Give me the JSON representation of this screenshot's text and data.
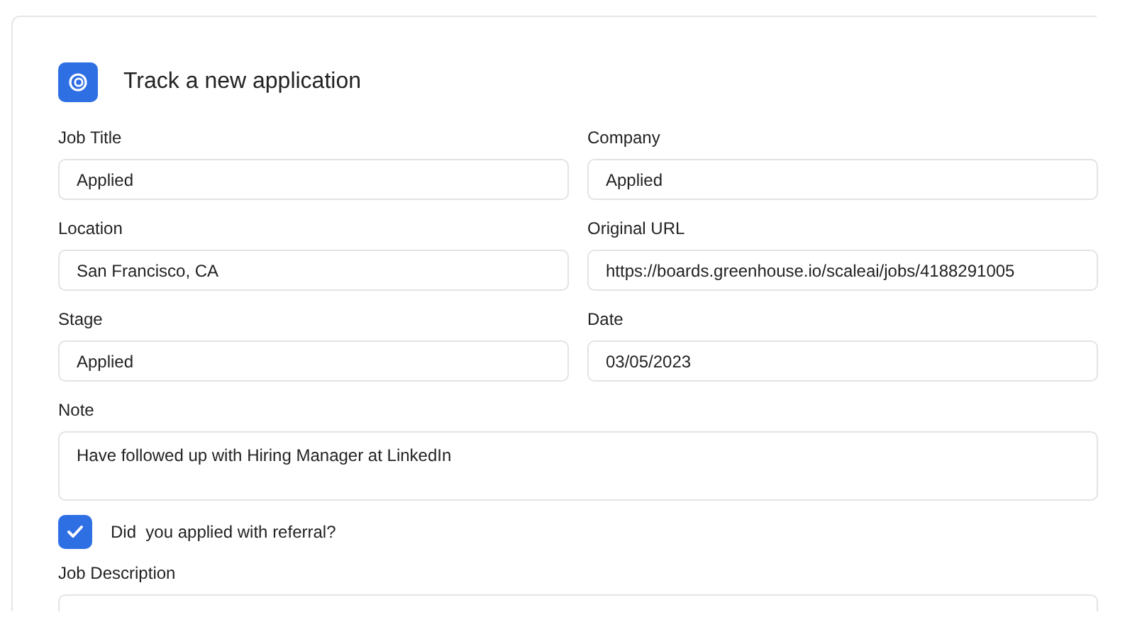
{
  "title": "Track a new application",
  "fields": [
    {
      "label": "Job Title",
      "value": "Applied"
    },
    {
      "label": "Company",
      "value": "Applied"
    },
    {
      "label": "Location",
      "value": "San Francisco, CA"
    },
    {
      "label": "Original URL",
      "value": "https://boards.greenhouse.io/scaleai/jobs/4188291005"
    },
    {
      "label": "Stage",
      "value": "Applied"
    },
    {
      "label": "Date",
      "value": "03/05/2023"
    }
  ],
  "note": {
    "label": "Note",
    "value": "Have followed up with Hiring Manager at LinkedIn"
  },
  "referral": {
    "label": "Did  you applied with referral?",
    "checked": true
  },
  "job_description": {
    "label": "Job Description"
  }
}
